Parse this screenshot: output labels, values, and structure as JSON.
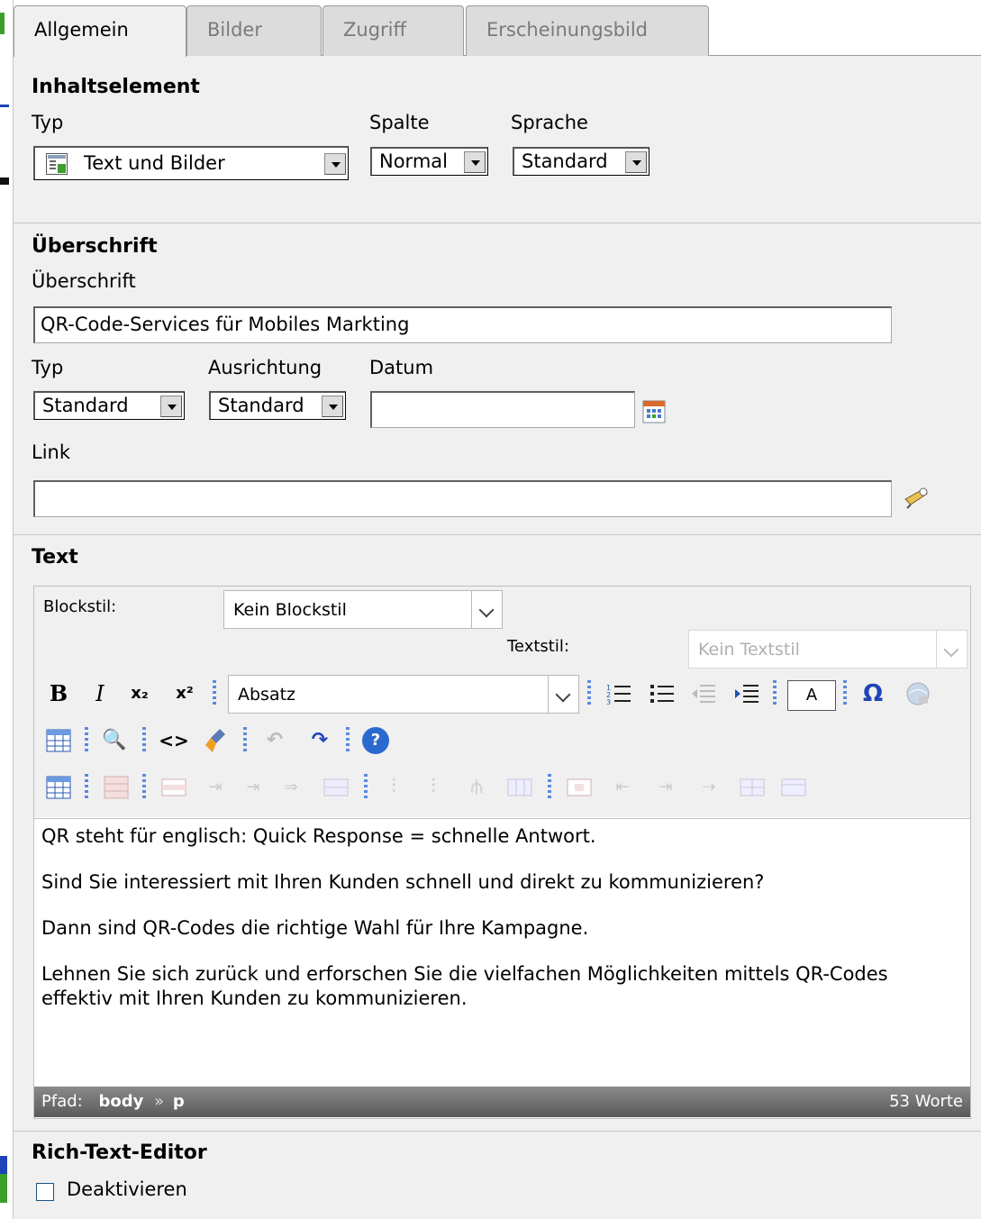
{
  "tabs": [
    {
      "label": "Allgemein",
      "active": true
    },
    {
      "label": "Bilder",
      "active": false
    },
    {
      "label": "Zugriff",
      "active": false
    },
    {
      "label": "Erscheinungsbild",
      "active": false
    }
  ],
  "inhaltselement": {
    "heading": "Inhaltselement",
    "typ_label": "Typ",
    "typ_value": "Text und Bilder",
    "spalte_label": "Spalte",
    "spalte_value": "Normal",
    "sprache_label": "Sprache",
    "sprache_value": "Standard"
  },
  "ueberschrift": {
    "heading": "Überschrift",
    "field_label": "Überschrift",
    "field_value": "QR-Code-Services für Mobiles Markting",
    "typ_label": "Typ",
    "typ_value": "Standard",
    "ausrichtung_label": "Ausrichtung",
    "ausrichtung_value": "Standard",
    "datum_label": "Datum",
    "datum_value": "",
    "link_label": "Link",
    "link_value": ""
  },
  "text": {
    "heading": "Text",
    "blockstil_label": "Blockstil:",
    "blockstil_value": "Kein Blockstil",
    "textstil_label": "Textstil:",
    "textstil_value": "Kein Textstil",
    "format_value": "Absatz",
    "paragraphs": [
      "QR steht für englisch: Quick Response = schnelle Antwort.",
      "Sind Sie interessiert mit Ihren Kunden schnell und direkt zu kommunizieren?",
      "Dann sind QR-Codes die richtige Wahl für Ihre Kampagne.",
      "Lehnen Sie sich zurück und erforschen Sie die vielfachen Möglichkeiten mittels QR-Codes effektiv mit Ihren Kunden zu kommunizieren."
    ],
    "path_label": "Pfad:",
    "path_body": "body",
    "path_sep": "»",
    "path_p": "p",
    "word_count": "53 Worte"
  },
  "rte": {
    "heading": "Rich-Text-Editor",
    "disable_label": "Deaktivieren"
  },
  "toolbar_icons": {
    "bold": "B",
    "italic": "I",
    "subscript": "x₂",
    "superscript": "x²",
    "char_a": "A",
    "omega": "Ω",
    "binoculars": "🔍",
    "code": "<>",
    "help": "?",
    "undo": "↶",
    "redo": "↷"
  },
  "colors": {
    "accent": "#1f44b8",
    "green_mark": "#3aa02a",
    "statusbar": "#6a6a6a"
  }
}
